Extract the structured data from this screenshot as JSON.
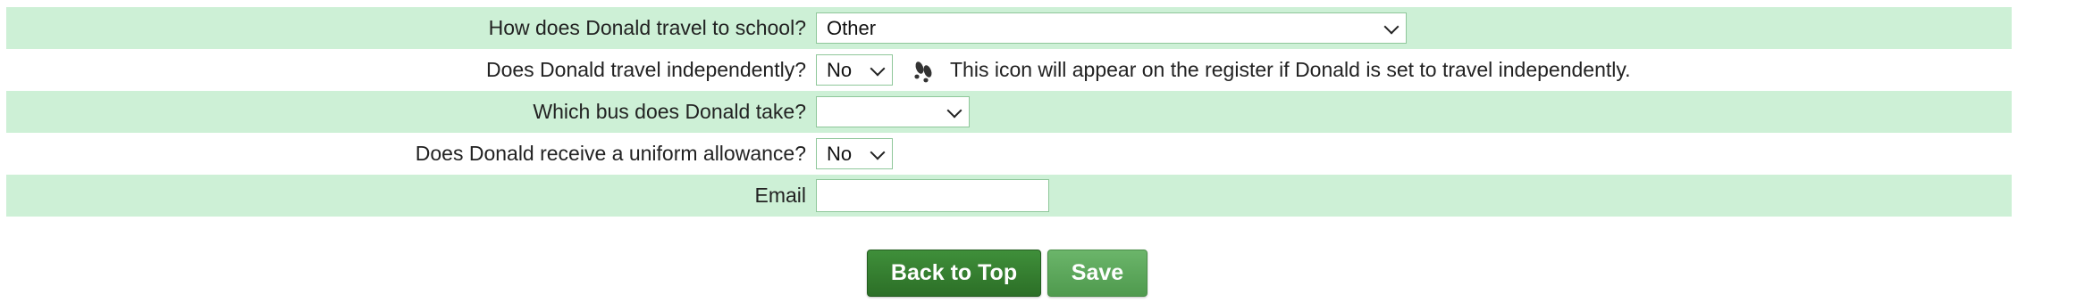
{
  "form": {
    "rows": [
      {
        "label": "How does Donald travel to school?",
        "value": "Other"
      },
      {
        "label": "Does Donald travel independently?",
        "value": "No",
        "note": "This icon will appear on the register if Donald is set to travel independently.",
        "note_icon": "footprints-icon"
      },
      {
        "label": "Which bus does Donald take?",
        "value": ""
      },
      {
        "label": "Does Donald receive a uniform allowance?",
        "value": "No"
      },
      {
        "label": "Email",
        "value": ""
      }
    ]
  },
  "buttons": {
    "back_to_top": "Back to Top",
    "save": "Save"
  },
  "colors": {
    "row_shade": "#cdf0d6",
    "primary_button": "#2c6f27",
    "secondary_button": "#4f9a4e"
  }
}
